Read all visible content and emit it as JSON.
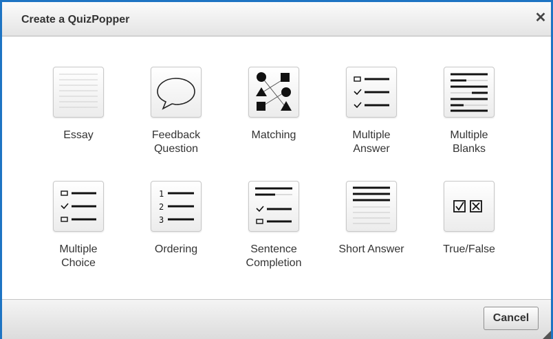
{
  "dialog": {
    "title": "Create a QuizPopper",
    "close_glyph": "✕",
    "cancel_label": "Cancel",
    "accent_color": "#1e74c3"
  },
  "items": [
    {
      "label": "Essay",
      "icon": "essay-icon"
    },
    {
      "label": "Feedback\nQuestion",
      "icon": "speech-bubble-icon"
    },
    {
      "label": "Matching",
      "icon": "matching-icon"
    },
    {
      "label": "Multiple\nAnswer",
      "icon": "multiple-answer-icon"
    },
    {
      "label": "Multiple\nBlanks",
      "icon": "multiple-blanks-icon"
    },
    {
      "label": "Multiple\nChoice",
      "icon": "multiple-choice-icon"
    },
    {
      "label": "Ordering",
      "icon": "ordering-icon"
    },
    {
      "label": "Sentence\nCompletion",
      "icon": "sentence-completion-icon"
    },
    {
      "label": "Short Answer",
      "icon": "short-answer-icon"
    },
    {
      "label": "True/False",
      "icon": "true-false-icon"
    }
  ]
}
